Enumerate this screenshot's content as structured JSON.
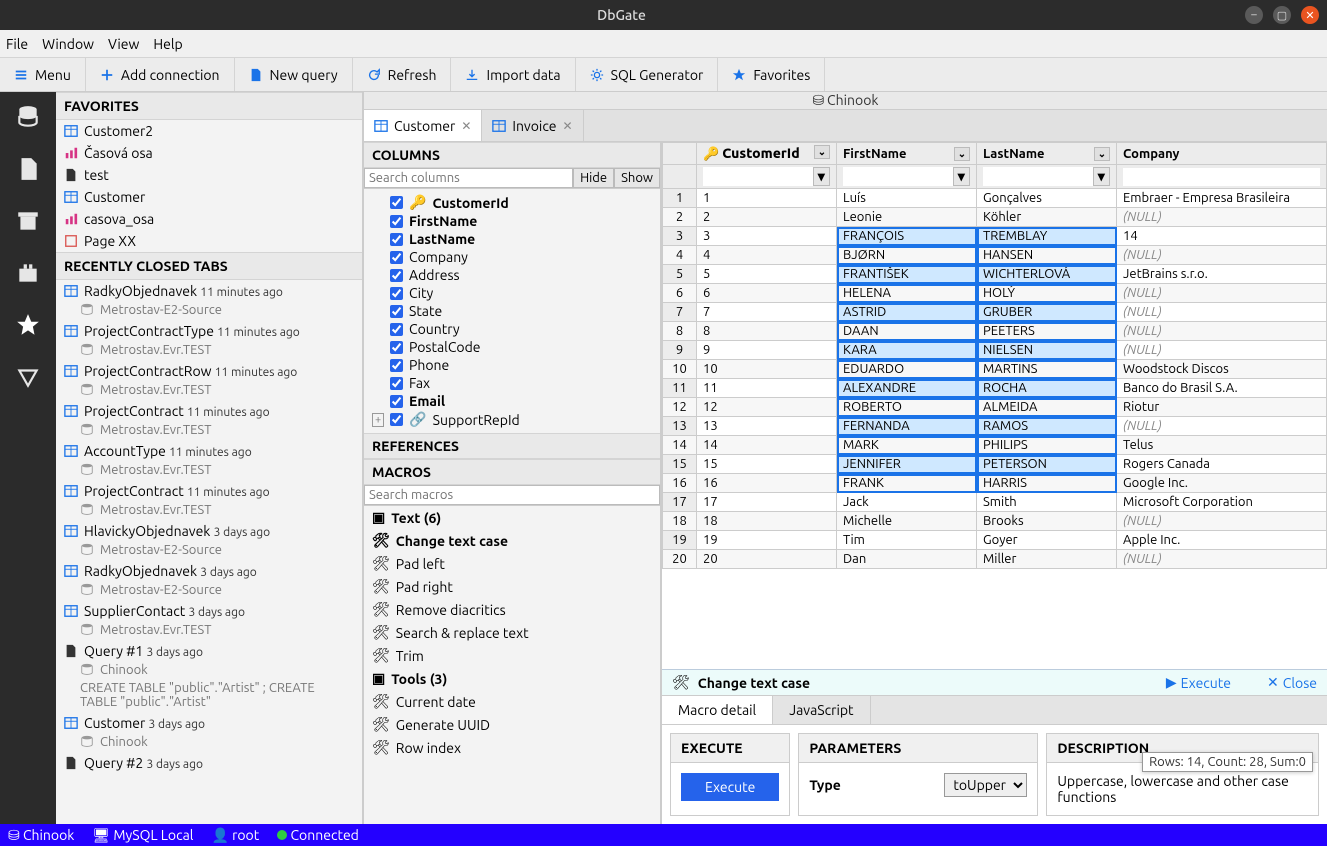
{
  "window": {
    "title": "DbGate"
  },
  "menubar": [
    "File",
    "Window",
    "View",
    "Help"
  ],
  "toolbar": [
    {
      "icon": "menu",
      "label": "Menu"
    },
    {
      "icon": "plus",
      "label": "Add connection"
    },
    {
      "icon": "doc",
      "label": "New query"
    },
    {
      "icon": "refresh",
      "label": "Refresh"
    },
    {
      "icon": "import",
      "label": "Import data"
    },
    {
      "icon": "gear",
      "label": "SQL Generator"
    },
    {
      "icon": "star",
      "label": "Favorites"
    }
  ],
  "favorites": {
    "title": "FAVORITES",
    "items": [
      {
        "icon": "table",
        "label": "Customer2"
      },
      {
        "icon": "chart",
        "label": "Časová osa"
      },
      {
        "icon": "file",
        "label": "test"
      },
      {
        "icon": "table",
        "label": "Customer"
      },
      {
        "icon": "chart",
        "label": "casova_osa"
      },
      {
        "icon": "page",
        "label": "Page XX"
      }
    ]
  },
  "recent": {
    "title": "RECENTLY CLOSED TABS",
    "items": [
      {
        "icon": "table",
        "label": "RadkyObjednavek",
        "time": "11 minutes ago",
        "sub": "Metrostav-E2-Source"
      },
      {
        "icon": "table",
        "label": "ProjectContractType",
        "time": "11 minutes ago",
        "sub": "Metrostav.Evr.TEST"
      },
      {
        "icon": "table",
        "label": "ProjectContractRow",
        "time": "11 minutes ago",
        "sub": "Metrostav.Evr.TEST"
      },
      {
        "icon": "table",
        "label": "ProjectContract",
        "time": "11 minutes ago",
        "sub": "Metrostav.Evr.TEST"
      },
      {
        "icon": "table",
        "label": "AccountType",
        "time": "11 minutes ago",
        "sub": "Metrostav.Evr.TEST"
      },
      {
        "icon": "table",
        "label": "ProjectContract",
        "time": "11 minutes ago",
        "sub": "Metrostav.Evr.TEST"
      },
      {
        "icon": "table",
        "label": "HlavickyObjednavek",
        "time": "3 days ago",
        "sub": "Metrostav-E2-Source"
      },
      {
        "icon": "table",
        "label": "RadkyObjednavek",
        "time": "3 days ago",
        "sub": "Metrostav-E2-Source"
      },
      {
        "icon": "table",
        "label": "SupplierContact",
        "time": "3 days ago",
        "sub": "Metrostav.Evr.TEST"
      },
      {
        "icon": "file",
        "label": "Query #1",
        "time": "3 days ago",
        "sub": "Chinook",
        "extra": "CREATE TABLE \"public\".\"Artist\" ; CREATE TABLE \"public\".\"Artist\""
      },
      {
        "icon": "table",
        "label": "Customer",
        "time": "3 days ago",
        "sub": "Chinook"
      },
      {
        "icon": "file",
        "label": "Query #2",
        "time": "3 days ago",
        "sub": ""
      }
    ]
  },
  "dbcontext": "Chinook",
  "tabs": [
    {
      "label": "Customer",
      "active": true
    },
    {
      "label": "Invoice",
      "active": false
    }
  ],
  "columnsPanel": {
    "title": "COLUMNS",
    "searchPlaceholder": "Search columns",
    "hide": "Hide",
    "show": "Show",
    "cols": [
      {
        "name": "CustomerId",
        "bold": true,
        "pk": true
      },
      {
        "name": "FirstName",
        "bold": true
      },
      {
        "name": "LastName",
        "bold": true
      },
      {
        "name": "Company"
      },
      {
        "name": "Address"
      },
      {
        "name": "City"
      },
      {
        "name": "State"
      },
      {
        "name": "Country"
      },
      {
        "name": "PostalCode"
      },
      {
        "name": "Phone"
      },
      {
        "name": "Fax"
      },
      {
        "name": "Email",
        "bold": true
      },
      {
        "name": "SupportRepId",
        "fk": true
      }
    ],
    "references": "REFERENCES",
    "macrosTitle": "MACROS",
    "macroSearch": "Search macros",
    "macros": [
      {
        "type": "group",
        "label": "Text (6)"
      },
      {
        "type": "sel",
        "label": "Change text case"
      },
      {
        "type": "item",
        "label": "Pad left"
      },
      {
        "type": "item",
        "label": "Pad right"
      },
      {
        "type": "item",
        "label": "Remove diacritics"
      },
      {
        "type": "item",
        "label": "Search & replace text"
      },
      {
        "type": "item",
        "label": "Trim"
      },
      {
        "type": "group",
        "label": "Tools (3)"
      },
      {
        "type": "item",
        "label": "Current date"
      },
      {
        "type": "item",
        "label": "Generate UUID"
      },
      {
        "type": "item",
        "label": "Row index"
      }
    ]
  },
  "grid": {
    "headers": [
      "CustomerId",
      "FirstName",
      "LastName",
      "Company"
    ],
    "rows": [
      {
        "n": 1,
        "id": "1",
        "f": "Luís",
        "l": "Gonçalves",
        "c": "Embraer - Empresa Brasileira"
      },
      {
        "n": 2,
        "id": "2",
        "f": "Leonie",
        "l": "Köhler",
        "c": "(NULL)",
        "nullc": true
      },
      {
        "n": 3,
        "id": "3",
        "f": "FRANÇOIS",
        "l": "TREMBLAY",
        "c": "14",
        "sel": true
      },
      {
        "n": 4,
        "id": "4",
        "f": "BJØRN",
        "l": "HANSEN",
        "c": "(NULL)",
        "nullc": true,
        "sel": true
      },
      {
        "n": 5,
        "id": "5",
        "f": "FRANTIŠEK",
        "l": "WICHTERLOVÁ",
        "c": "JetBrains s.r.o.",
        "sel": true
      },
      {
        "n": 6,
        "id": "6",
        "f": "HELENA",
        "l": "HOLÝ",
        "c": "(NULL)",
        "nullc": true,
        "sel": true
      },
      {
        "n": 7,
        "id": "7",
        "f": "ASTRID",
        "l": "GRUBER",
        "c": "(NULL)",
        "nullc": true,
        "sel": true
      },
      {
        "n": 8,
        "id": "8",
        "f": "DAAN",
        "l": "PEETERS",
        "c": "(NULL)",
        "nullc": true,
        "sel": true
      },
      {
        "n": 9,
        "id": "9",
        "f": "KARA",
        "l": "NIELSEN",
        "c": "(NULL)",
        "nullc": true,
        "sel": true
      },
      {
        "n": 10,
        "id": "10",
        "f": "EDUARDO",
        "l": "MARTINS",
        "c": "Woodstock Discos",
        "sel": true
      },
      {
        "n": 11,
        "id": "11",
        "f": "ALEXANDRE",
        "l": "ROCHA",
        "c": "Banco do Brasil S.A.",
        "sel": true
      },
      {
        "n": 12,
        "id": "12",
        "f": "ROBERTO",
        "l": "ALMEIDA",
        "c": "Riotur",
        "sel": true
      },
      {
        "n": 13,
        "id": "13",
        "f": "FERNANDA",
        "l": "RAMOS",
        "c": "(NULL)",
        "nullc": true,
        "sel": true
      },
      {
        "n": 14,
        "id": "14",
        "f": "MARK",
        "l": "PHILIPS",
        "c": "Telus",
        "sel": true
      },
      {
        "n": 15,
        "id": "15",
        "f": "JENNIFER",
        "l": "PETERSON",
        "c": "Rogers Canada",
        "sel": true
      },
      {
        "n": 16,
        "id": "16",
        "f": "FRANK",
        "l": "HARRIS",
        "c": "Google Inc.",
        "sel": true
      },
      {
        "n": 17,
        "id": "17",
        "f": "Jack",
        "l": "Smith",
        "c": "Microsoft Corporation"
      },
      {
        "n": 18,
        "id": "18",
        "f": "Michelle",
        "l": "Brooks",
        "c": "(NULL)",
        "nullc": true
      },
      {
        "n": 19,
        "id": "19",
        "f": "Tim",
        "l": "Goyer",
        "c": "Apple Inc."
      },
      {
        "n": 20,
        "id": "20",
        "f": "Dan",
        "l": "Miller",
        "c": "(NULL)",
        "nullc": true
      }
    ],
    "stat": "Rows: 14, Count: 28, Sum:0"
  },
  "macrobar": {
    "title": "Change text case",
    "execute": "Execute",
    "close": "Close"
  },
  "macrotabs": [
    "Macro detail",
    "JavaScript"
  ],
  "macrodetail": {
    "execHead": "EXECUTE",
    "execBtn": "Execute",
    "paramHead": "PARAMETERS",
    "paramLabel": "Type",
    "paramValue": "toUpper",
    "descHead": "DESCRIPTION",
    "descText": "Uppercase, lowercase and other case functions"
  },
  "status": {
    "db": "Chinook",
    "server": "MySQL Local",
    "user": "root",
    "conn": "Connected"
  }
}
